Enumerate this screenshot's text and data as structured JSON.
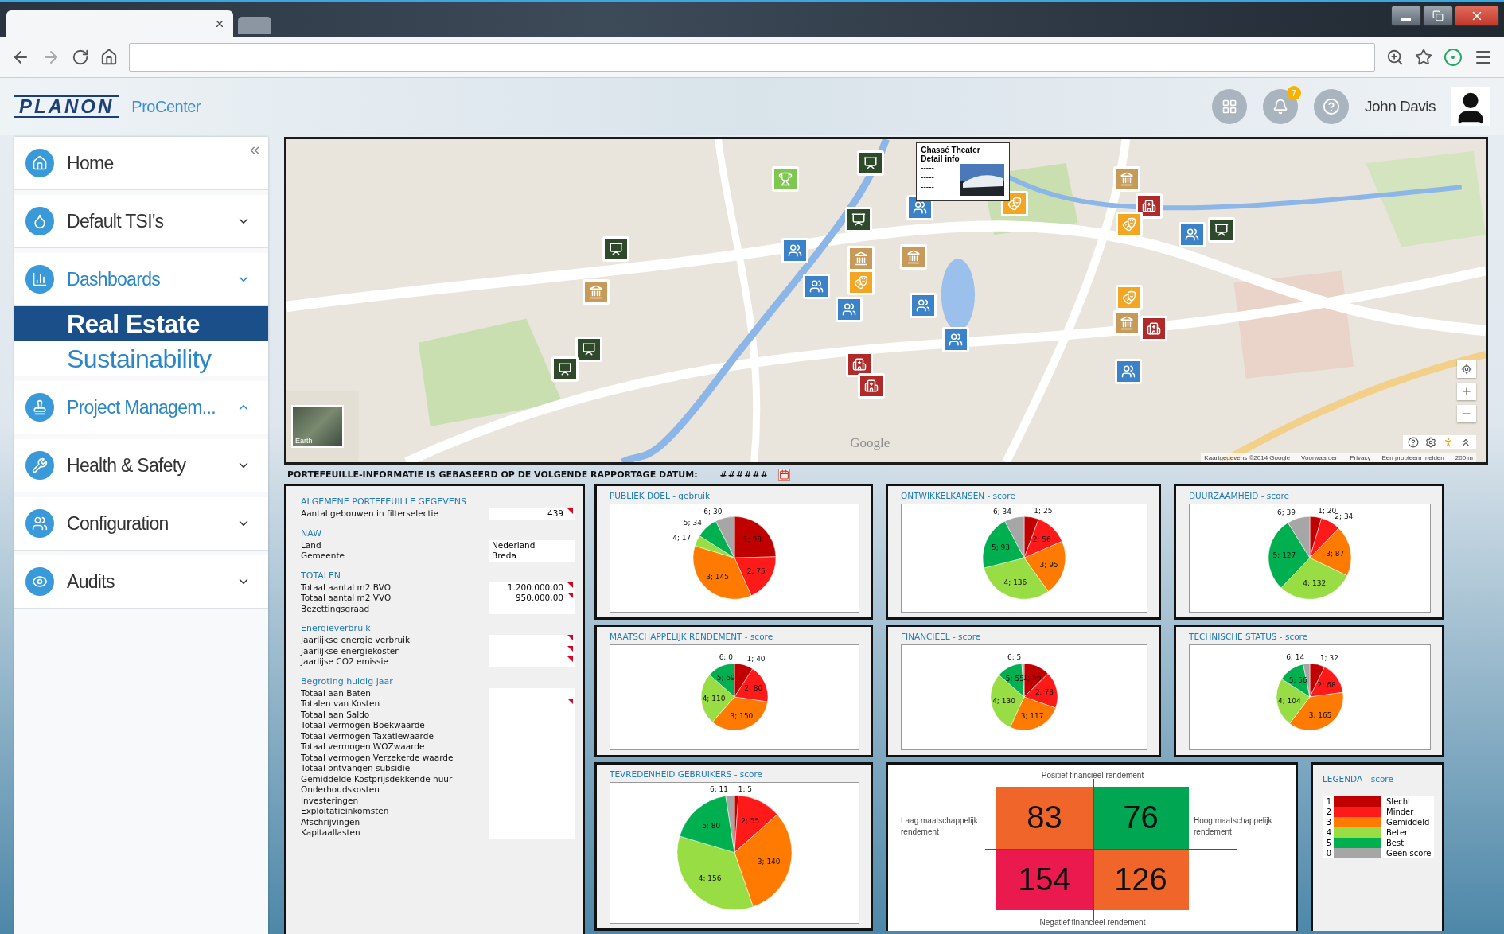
{
  "header": {
    "logo": "PLANON",
    "product": "ProCenter",
    "notification_count": "7",
    "user": "John Davis"
  },
  "sidebar": {
    "items": [
      {
        "label": "Home",
        "highlighted": false
      },
      {
        "label": "Default TSI's",
        "expanded": false,
        "highlighted": false
      },
      {
        "label": "Dashboards",
        "expanded": false,
        "highlighted": true,
        "children": [
          {
            "label": "Real Estate",
            "selected": true
          },
          {
            "label": "Sustainability",
            "selected": false
          }
        ]
      },
      {
        "label": "Project Managem...",
        "expanded": true,
        "highlighted": true
      },
      {
        "label": "Health & Safety",
        "expanded": false,
        "highlighted": false
      },
      {
        "label": "Configuration",
        "expanded": false,
        "highlighted": false
      },
      {
        "label": "Audits",
        "expanded": false,
        "highlighted": false
      }
    ]
  },
  "map": {
    "popup": {
      "title": "Chassé Theater",
      "subtitle": "Detail info",
      "lines": [
        "-----",
        "-----",
        "-----"
      ]
    },
    "layer_button": "Earth",
    "logo": "Google",
    "attribution": [
      "Kaartgegevens ©2014 Google",
      "Voorwaarden",
      "Privacy",
      "Een probleem melden",
      "200 m"
    ]
  },
  "report_date": {
    "label": "PORTEFEUILLE-INFORMATIE IS GEBASEERD OP DE VOLGENDE RAPPORTAGE DATUM:",
    "value": "######"
  },
  "portfolio_info": {
    "sections": [
      {
        "heading": "ALGEMENE PORTEFEUILLE GEGEVENS",
        "rows": [
          {
            "label": "Aantal gebouwen in filterselectie",
            "value": "439",
            "flagged": true
          }
        ]
      },
      {
        "heading": "NAW",
        "rows": [
          {
            "label": "Land",
            "value": "Nederland",
            "flagged": false
          },
          {
            "label": "Gemeente",
            "value": "Breda",
            "flagged": false
          }
        ]
      },
      {
        "heading": "TOTALEN",
        "rows": [
          {
            "label": "Totaal aantal m2 BVO",
            "value": "1.200.000,00",
            "flagged": true
          },
          {
            "label": "Totaal aantal m2 VVO",
            "value": "950.000,00",
            "flagged": true
          },
          {
            "label": "Bezettingsgraad",
            "flagged": false
          }
        ]
      },
      {
        "heading": "Energieverbruik",
        "rows": [
          {
            "label": "Jaarlijkse energie verbruik",
            "flagged": true
          },
          {
            "label": "Jaarlijkse energiekosten",
            "flagged": true
          },
          {
            "label": "Jaarlijse CO2 emissie",
            "flagged": true
          }
        ]
      },
      {
        "heading": "Begroting huidig jaar",
        "rows": [
          {
            "label": "Totaal aan Baten",
            "flagged": false
          },
          {
            "label": "Totalen van Kosten",
            "flagged": true
          },
          {
            "label": "Totaal aan Saldo",
            "flagged": false
          },
          {
            "label": "Totaal vermogen Boekwaarde",
            "flagged": false
          },
          {
            "label": "Totaal vermogen Taxatiewaarde",
            "flagged": false
          },
          {
            "label": "Totaal vermogen WOZwaarde",
            "flagged": false
          },
          {
            "label": "Totaal vermogen Verzekerde waarde",
            "flagged": false
          },
          {
            "label": "Totaal ontvangen subsidie",
            "flagged": false
          },
          {
            "label": "Gemiddelde Kostprijsdekkende huur",
            "flagged": false
          },
          {
            "label": "Onderhoudskosten",
            "flagged": false
          },
          {
            "label": "Investeringen",
            "flagged": false
          },
          {
            "label": "Exploitatieinkomsten",
            "flagged": false
          },
          {
            "label": "Afschrijvingen",
            "flagged": false
          },
          {
            "label": "Kapitaallasten",
            "flagged": false
          }
        ]
      }
    ]
  },
  "charts": [
    {
      "chart_data": {
        "type": "pie",
        "title": "PUBLIEK DOEL - gebruik",
        "values": [
          98,
          75,
          145,
          17,
          34,
          30
        ],
        "data_labels": true,
        "value_labels": [
          "1; 98",
          "2; 75",
          "3; 145",
          "4; 17",
          "5; 34",
          "6; 30"
        ]
      }
    },
    {
      "chart_data": {
        "type": "pie",
        "title": "ONTWIKKELKANSEN - score",
        "values": [
          25,
          56,
          95,
          136,
          93,
          34
        ],
        "data_labels": true,
        "value_labels": [
          "1; 25",
          "2; 56",
          "3; 95",
          "4; 136",
          "5; 93",
          "6; 34"
        ]
      }
    },
    {
      "chart_data": {
        "type": "pie",
        "title": "DUURZAAMHEID - score",
        "values": [
          20,
          34,
          87,
          132,
          127,
          39
        ],
        "data_labels": true,
        "value_labels": [
          "1; 20",
          "2; 34",
          "3; 87",
          "4; 132",
          "5; 127",
          "6; 39"
        ]
      }
    },
    {
      "chart_data": {
        "type": "pie",
        "title": "MAATSCHAPPELIJK RENDEMENT - score",
        "values": [
          40,
          80,
          150,
          110,
          59,
          0
        ],
        "data_labels": true,
        "value_labels": [
          "1; 40",
          "2; 80",
          "3; 150",
          "4; 110",
          "5; 59",
          "6; 0"
        ]
      }
    },
    {
      "chart_data": {
        "type": "pie",
        "title": "FINANCIEEL - score",
        "values": [
          56,
          78,
          117,
          130,
          55,
          5
        ],
        "data_labels": true,
        "value_labels": [
          "1; 56",
          "2; 78",
          "3; 117",
          "4; 130",
          "5; 55",
          "6; 5"
        ]
      }
    },
    {
      "chart_data": {
        "type": "pie",
        "title": "TECHNISCHE STATUS - score",
        "values": [
          32,
          68,
          165,
          104,
          56,
          14
        ],
        "data_labels": true,
        "value_labels": [
          "1; 32",
          "2; 68",
          "3; 165",
          "4; 104",
          "5; 56",
          "6; 14"
        ]
      }
    },
    {
      "chart_data": {
        "type": "pie",
        "title": "TEVREDENHEID GEBRUIKERS - score",
        "values": [
          5,
          55,
          140,
          156,
          80,
          11
        ],
        "data_labels": true,
        "value_labels": [
          "1; 5",
          "2; 55",
          "3; 140",
          "4; 156",
          "5; 80",
          "6; 11"
        ]
      }
    }
  ],
  "matrix": {
    "top_label": "Positief financieel rendement",
    "bottom_label": "Negatief financieel rendement",
    "left_label": "Laag maatschappelijk rendement",
    "right_label": "Hoog maatschappelijk rendement",
    "cells": [
      {
        "value": "83",
        "color": "#f0662a"
      },
      {
        "value": "76",
        "color": "#00a651"
      },
      {
        "value": "154",
        "color": "#ea1a4f"
      },
      {
        "value": "126",
        "color": "#f0662a"
      }
    ]
  },
  "legend": {
    "title": "LEGENDA - score",
    "items": [
      {
        "key": "1",
        "label": "Slecht",
        "color": "#c00000"
      },
      {
        "key": "2",
        "label": "Minder",
        "color": "#ff1a1a"
      },
      {
        "key": "3",
        "label": "Gemiddeld",
        "color": "#ff7a00"
      },
      {
        "key": "4",
        "label": "Beter",
        "color": "#99dd44"
      },
      {
        "key": "5",
        "label": "Best",
        "color": "#00b050"
      },
      {
        "key": "0",
        "label": "Geen score",
        "color": "#a6a6a6"
      }
    ]
  }
}
